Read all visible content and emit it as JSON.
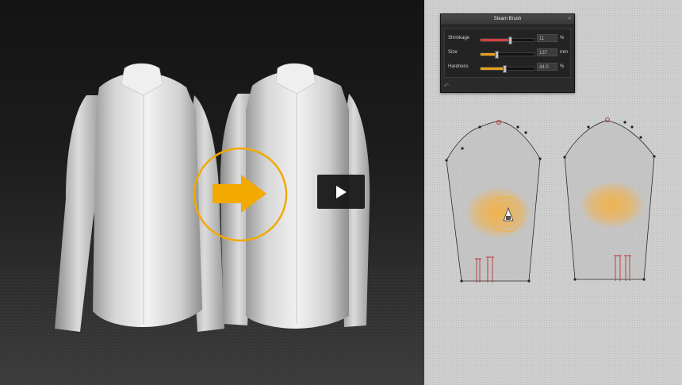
{
  "brush_panel": {
    "title": "Steam Brush",
    "close_glyph": "×",
    "back_glyph": "↶",
    "sliders": [
      {
        "label": "Shrinkage",
        "value": "11",
        "unit": "%",
        "fraction": 0.55,
        "color": "#d24040"
      },
      {
        "label": "Size",
        "value": "137",
        "unit": "mm",
        "fraction": 0.3,
        "color": "#e6a21b"
      },
      {
        "label": "Hardness",
        "value": "44.0",
        "unit": "%",
        "fraction": 0.44,
        "color": "#e6a21b"
      }
    ]
  },
  "icons": {
    "arrow": "right-arrow-icon",
    "play": "play-icon",
    "cursor": "steam-iron-cursor-icon"
  },
  "colors": {
    "accent": "#f2a900",
    "steam": "#f5b041"
  }
}
